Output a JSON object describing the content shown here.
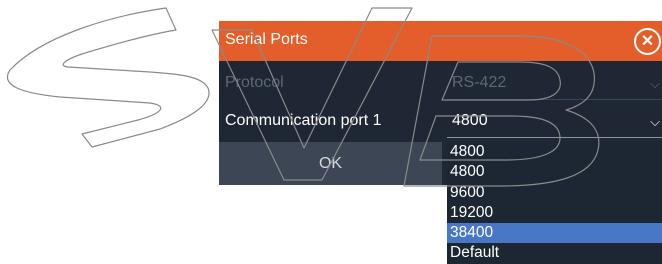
{
  "dialog": {
    "title": "Serial Ports",
    "close_icon": "close-circle-icon",
    "protocol": {
      "label": "Protocol",
      "value": "RS-422",
      "enabled": false
    },
    "port": {
      "label": "Communication port 1",
      "value": "4800"
    },
    "ok_label": "OK"
  },
  "dropdown": {
    "options": [
      "4800",
      "4800",
      "9600",
      "19200",
      "38400",
      "Default"
    ],
    "selected_index": 4
  },
  "watermark": "SVB",
  "colors": {
    "titlebar": "#e35e2b",
    "dialog_bg": "#1e2733",
    "button_bg": "#3c4654",
    "highlight": "#4877c6",
    "disabled_text": "#5d6773"
  }
}
